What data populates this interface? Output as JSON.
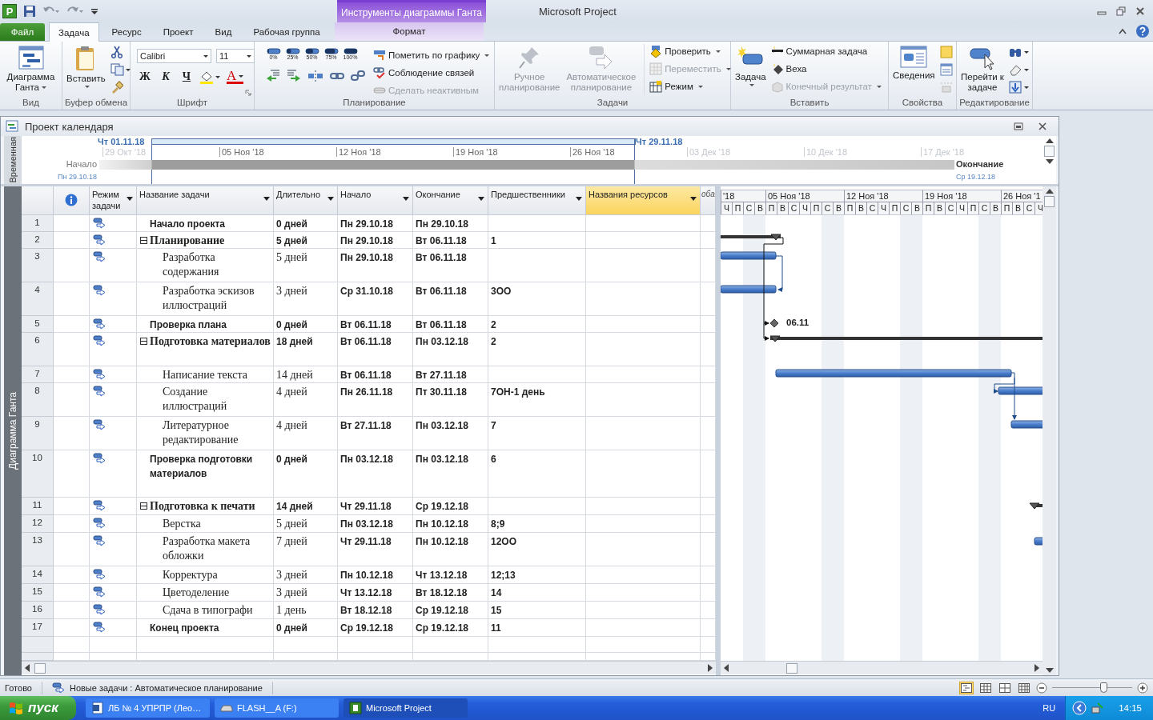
{
  "title_bar": {
    "logo_letter": "P",
    "title": "Microsoft Project",
    "context_group": "Инструменты диаграммы Ганта"
  },
  "tabs": [
    {
      "label": "Файл",
      "kind": "file",
      "selected": false
    },
    {
      "label": "Задача",
      "kind": "main",
      "selected": true
    },
    {
      "label": "Ресурс",
      "kind": "main",
      "selected": false
    },
    {
      "label": "Проект",
      "kind": "main",
      "selected": false
    },
    {
      "label": "Вид",
      "kind": "main",
      "selected": false
    },
    {
      "label": "Рабочая группа",
      "kind": "main",
      "selected": false
    },
    {
      "label": "Формат",
      "kind": "context",
      "selected": false
    }
  ],
  "ribbon": {
    "view": {
      "label": "Вид",
      "gantt_button": "Диаграмма Ганта"
    },
    "clipboard": {
      "label": "Буфер обмена",
      "paste_button": "Вставить"
    },
    "font": {
      "label": "Шрифт",
      "font_name": "Calibri",
      "font_size": "11",
      "bold": "Ж",
      "italic": "К",
      "underline": "Ч",
      "font_color_glyph": "A"
    },
    "schedule": {
      "label": "Планирование",
      "percent_buttons": [
        "0%",
        "25%",
        "50%",
        "75%",
        "100%"
      ],
      "commands": [
        {
          "label": "Пометить по графику",
          "dropdown": true,
          "disabled": false
        },
        {
          "label": "Соблюдение связей",
          "dropdown": false,
          "disabled": false
        },
        {
          "label": "Сделать неактивным",
          "dropdown": false,
          "disabled": true
        }
      ]
    },
    "tasks": {
      "label": "Задачи",
      "manual_button": {
        "label": "Ручное планирование",
        "disabled": true
      },
      "auto_button": {
        "label": "Автоматическое планирование",
        "disabled": true
      },
      "commands": [
        {
          "label": "Проверить",
          "dropdown": true,
          "disabled": false
        },
        {
          "label": "Переместить",
          "dropdown": true,
          "disabled": true
        },
        {
          "label": "Режим",
          "dropdown": true,
          "disabled": false
        }
      ]
    },
    "insert": {
      "label": "Вставить",
      "task_button": "Задача",
      "commands": [
        {
          "label": "Суммарная задача",
          "dropdown": false,
          "disabled": false
        },
        {
          "label": "Веха",
          "dropdown": false,
          "disabled": false
        },
        {
          "label": "Конечный результат",
          "dropdown": true,
          "disabled": true
        }
      ]
    },
    "properties": {
      "label": "Свойства",
      "info_button": "Сведения"
    },
    "editing": {
      "label": "Редактирование",
      "goto_button": "Перейти к задаче"
    }
  },
  "document": {
    "title": "Проект календаря"
  },
  "timeline": {
    "side_label": "Временная",
    "bracket_start": "Чт 01.11.18",
    "bracket_end": "Чт 29.11.18",
    "start_label": "Начало",
    "start_date": "Пн 29.10.18",
    "end_label": "Окончание",
    "end_date": "Ср 19.12.18",
    "ticks": [
      {
        "label": "29 Окт '18",
        "in_range": false
      },
      {
        "label": "05 Ноя '18",
        "in_range": true
      },
      {
        "label": "12 Ноя '18",
        "in_range": true
      },
      {
        "label": "19 Ноя '18",
        "in_range": true
      },
      {
        "label": "26 Ноя '18",
        "in_range": true
      },
      {
        "label": "03 Дек '18",
        "in_range": false
      },
      {
        "label": "10 Дек '18",
        "in_range": false
      },
      {
        "label": "17 Дек '18",
        "in_range": false
      }
    ]
  },
  "view_bar": {
    "label": "Диаграмма Ганта"
  },
  "table": {
    "columns": [
      {
        "kind": "info",
        "selected": false
      },
      {
        "kind": "field",
        "label": "Режим задачи",
        "selected": false
      },
      {
        "kind": "field",
        "label": "Название задачи",
        "selected": false
      },
      {
        "kind": "field",
        "label": "Длительно",
        "selected": false
      },
      {
        "kind": "field",
        "label": "Начало",
        "selected": false
      },
      {
        "kind": "field",
        "label": "Окончание",
        "selected": false
      },
      {
        "kind": "field",
        "label": "Предшественники",
        "selected": false
      },
      {
        "kind": "field",
        "label": "Названия ресурсов",
        "selected": true
      },
      {
        "kind": "partial",
        "label": "оба",
        "selected": false
      }
    ],
    "tasks": [
      {
        "num": "1",
        "name": "Начало проекта",
        "kind": "milestone",
        "duration": "0 дней",
        "start": "Пн 29.10.18",
        "finish": "Пн 29.10.18"
      },
      {
        "num": "2",
        "name": "Планирование",
        "kind": "summary",
        "expanded": true,
        "duration": "5 дней",
        "start": "Пн 29.10.18",
        "finish": "Вт 06.11.18",
        "predecessors": "1",
        "children": [
          {
            "num": "3",
            "name": "Разработка содержания",
            "kind": "task",
            "duration": "5 дней",
            "start": "Пн 29.10.18",
            "finish": "Вт 06.11.18"
          },
          {
            "num": "4",
            "name": "Разработка эскизов иллюстраций",
            "kind": "task",
            "duration": "3 дней",
            "start": "Ср 31.10.18",
            "finish": "Вт 06.11.18",
            "predecessors": "3ОО"
          }
        ]
      },
      {
        "num": "5",
        "name": "Проверка плана",
        "kind": "milestone",
        "duration": "0 дней",
        "start": "Вт 06.11.18",
        "finish": "Вт 06.11.18",
        "predecessors": "2"
      },
      {
        "num": "6",
        "name": "Подготовка материалов",
        "kind": "summary",
        "expanded": true,
        "duration": "18 дней",
        "start": "Вт 06.11.18",
        "finish": "Пн 03.12.18",
        "predecessors": "2",
        "children": [
          {
            "num": "7",
            "name": "Написание текста",
            "kind": "task",
            "duration": "14 дней",
            "start": "Вт 06.11.18",
            "finish": "Вт 27.11.18"
          },
          {
            "num": "8",
            "name": "Создание иллюстраций",
            "kind": "task",
            "duration": "4 дней",
            "start": "Пн 26.11.18",
            "finish": "Пт 30.11.18",
            "predecessors": "7ОН-1 день"
          },
          {
            "num": "9",
            "name": "Литературное редактирование",
            "kind": "task",
            "duration": "4 дней",
            "start": "Вт 27.11.18",
            "finish": "Пн 03.12.18",
            "predecessors": "7"
          }
        ]
      },
      {
        "num": "10",
        "name": "Проверка подготовки материалов",
        "kind": "milestone",
        "duration": "0 дней",
        "start": "Пн 03.12.18",
        "finish": "Пн 03.12.18",
        "predecessors": "6"
      },
      {
        "num": "11",
        "name": "Подготовка к печати",
        "kind": "summary",
        "expanded": true,
        "duration": "14 дней",
        "start": "Чт 29.11.18",
        "finish": "Ср 19.12.18",
        "children": [
          {
            "num": "12",
            "name": "Верстка",
            "kind": "task",
            "duration": "5 дней",
            "start": "Пн 03.12.18",
            "finish": "Пн 10.12.18",
            "predecessors": "8;9"
          },
          {
            "num": "13",
            "name": "Разработка макета обложки",
            "kind": "task",
            "duration": "7 дней",
            "start": "Чт 29.11.18",
            "finish": "Пн 10.12.18",
            "predecessors": "12ОО"
          },
          {
            "num": "14",
            "name": "Корректура",
            "kind": "task",
            "duration": "3 дней",
            "start": "Пн 10.12.18",
            "finish": "Чт 13.12.18",
            "predecessors": "12;13"
          },
          {
            "num": "15",
            "name": "Цветоделение",
            "kind": "task",
            "duration": "3 дней",
            "start": "Чт 13.12.18",
            "finish": "Вт 18.12.18",
            "predecessors": "14"
          },
          {
            "num": "16",
            "name": "Сдача в типографи",
            "kind": "task",
            "duration": "1 день",
            "start": "Вт 18.12.18",
            "finish": "Ср 19.12.18",
            "predecessors": "15"
          }
        ]
      },
      {
        "num": "17",
        "name": "Конец проекта",
        "kind": "milestone",
        "duration": "0 дней",
        "start": "Ср 19.12.18",
        "finish": "Ср 19.12.18",
        "predecessors": "11"
      }
    ]
  },
  "gantt": {
    "weeks": [
      {
        "label": "'18",
        "days": [
          "Ч",
          "П",
          "С",
          "В"
        ]
      },
      {
        "label": "05 Ноя '18",
        "days": [
          "П",
          "В",
          "С",
          "Ч",
          "П",
          "С",
          "В"
        ]
      },
      {
        "label": "12 Ноя '18",
        "days": [
          "П",
          "В",
          "С",
          "Ч",
          "П",
          "С",
          "В"
        ]
      },
      {
        "label": "19 Ноя '18",
        "days": [
          "П",
          "В",
          "С",
          "Ч",
          "П",
          "С",
          "В"
        ]
      },
      {
        "label": "26 Ноя '1",
        "days": [
          "П",
          "В",
          "С",
          "Ч"
        ]
      }
    ],
    "milestone_label": "06.11"
  },
  "status_bar": {
    "ready": "Готово",
    "new_tasks": "Новые задачи : Автоматическое планирование",
    "views": [
      {
        "selected": true
      },
      {
        "selected": false
      },
      {
        "selected": false
      },
      {
        "selected": false
      }
    ],
    "zoom": {
      "level": 0.64
    }
  },
  "taskbar": {
    "start": "пуск",
    "tasks": [
      {
        "label": "ЛБ № 4 УПРПР (Лео…",
        "selected": false
      },
      {
        "label": "FLASH__A (F:)",
        "selected": false
      },
      {
        "label": "Microsoft Project",
        "selected": true
      }
    ],
    "language": "RU",
    "clock": "14:15"
  }
}
